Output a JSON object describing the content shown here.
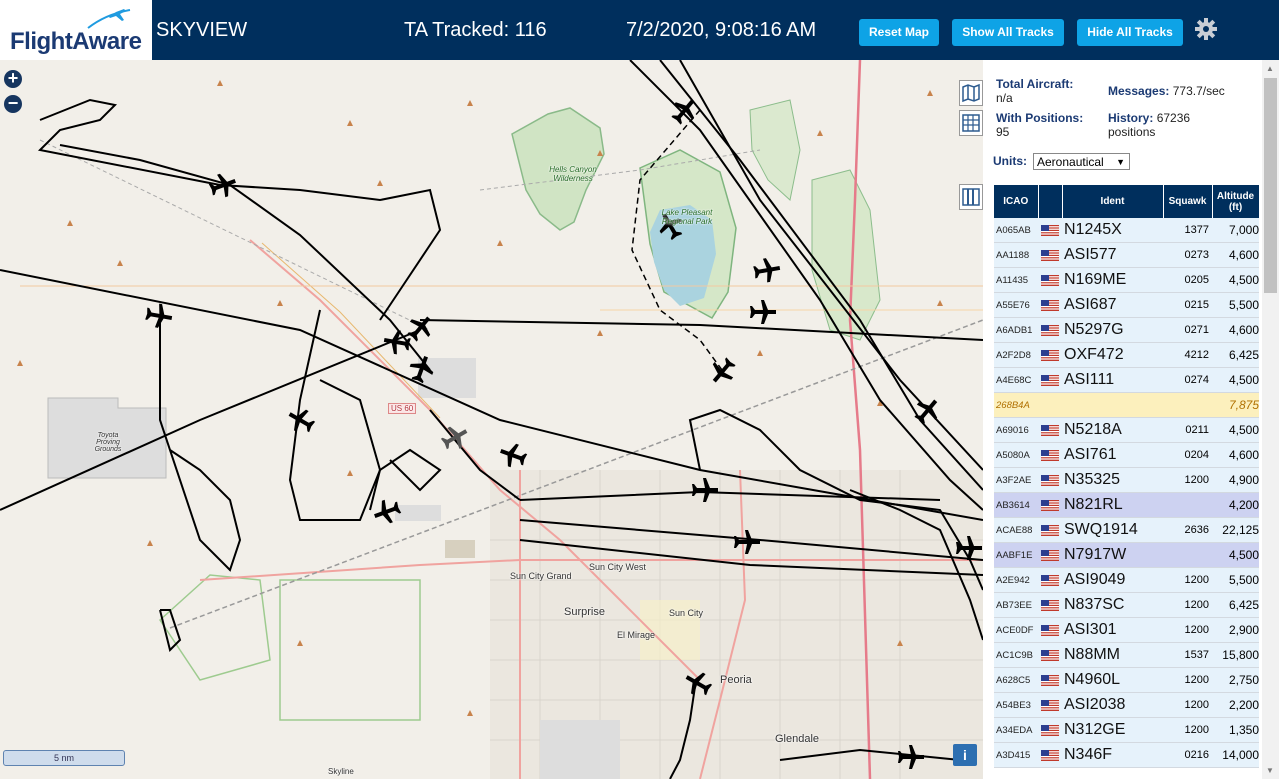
{
  "header": {
    "logo_text": "FlightAware",
    "app_title": "SKYVIEW",
    "tracked": "TA Tracked: 116",
    "datetime": "7/2/2020, 9:08:16 AM",
    "reset_label": "Reset Map",
    "show_label": "Show All Tracks",
    "hide_label": "Hide All Tracks"
  },
  "stats": {
    "total_label": "Total Aircraft:",
    "total_value": "n/a",
    "positions_label": "With Positions:",
    "positions_value": "95",
    "messages_label": "Messages:",
    "messages_value": "773.7/sec",
    "history_label": "History:",
    "history_value": "67236",
    "history_unit": "positions"
  },
  "units": {
    "label": "Units:",
    "value": "Aeronautical"
  },
  "table": {
    "headers": {
      "icao": "ICAO",
      "ident": "Ident",
      "squawk": "Squawk",
      "altitude": "Altitude (ft)"
    },
    "rows": [
      {
        "icao": "A065AB",
        "ident": "N1245X",
        "squawk": "1377",
        "alt": "7,000"
      },
      {
        "icao": "AA1188",
        "ident": "ASI577",
        "squawk": "0273",
        "alt": "4,600"
      },
      {
        "icao": "A11435",
        "ident": "N169ME",
        "squawk": "0205",
        "alt": "4,500"
      },
      {
        "icao": "A55E76",
        "ident": "ASI687",
        "squawk": "0215",
        "alt": "5,500"
      },
      {
        "icao": "A6ADB1",
        "ident": "N5297G",
        "squawk": "0271",
        "alt": "4,600"
      },
      {
        "icao": "A2F2D8",
        "ident": "OXF472",
        "squawk": "4212",
        "alt": "6,425"
      },
      {
        "icao": "A4E68C",
        "ident": "ASI111",
        "squawk": "0274",
        "alt": "4,500"
      },
      {
        "icao": "268B4A",
        "ident": "",
        "squawk": "",
        "alt": "7,875"
      },
      {
        "icao": "A69016",
        "ident": "N5218A",
        "squawk": "0211",
        "alt": "4,500"
      },
      {
        "icao": "A5080A",
        "ident": "ASI761",
        "squawk": "0204",
        "alt": "4,600"
      },
      {
        "icao": "A3F2AE",
        "ident": "N35325",
        "squawk": "1200",
        "alt": "4,900"
      },
      {
        "icao": "AB3614",
        "ident": "N821RL",
        "squawk": "",
        "alt": "4,200"
      },
      {
        "icao": "ACAE88",
        "ident": "SWQ1914",
        "squawk": "2636",
        "alt": "22,125"
      },
      {
        "icao": "AABF1E",
        "ident": "N7917W",
        "squawk": "",
        "alt": "4,500"
      },
      {
        "icao": "A2E942",
        "ident": "ASI9049",
        "squawk": "1200",
        "alt": "5,500"
      },
      {
        "icao": "AB73EE",
        "ident": "N837SC",
        "squawk": "1200",
        "alt": "6,425"
      },
      {
        "icao": "ACE0DF",
        "ident": "ASI301",
        "squawk": "1200",
        "alt": "2,900"
      },
      {
        "icao": "AC1C9B",
        "ident": "N88MM",
        "squawk": "1537",
        "alt": "15,800"
      },
      {
        "icao": "A628C5",
        "ident": "N4960L",
        "squawk": "1200",
        "alt": "2,750"
      },
      {
        "icao": "A54BE3",
        "ident": "ASI2038",
        "squawk": "1200",
        "alt": "2,200"
      },
      {
        "icao": "A34EDA",
        "ident": "N312GE",
        "squawk": "1200",
        "alt": "1,350"
      },
      {
        "icao": "A3D415",
        "ident": "N346F",
        "squawk": "0216",
        "alt": "14,000"
      }
    ]
  },
  "map": {
    "labels": {
      "hells_canyon": "Hells Canyon Wilderness",
      "lake_pleasant": "Lake Pleasant Regional Park",
      "toyota": "Toyota Proving Grounds",
      "us60": "US 60",
      "sun_city_grand": "Sun City Grand",
      "sun_city_west": "Sun City West",
      "surprise": "Surprise",
      "sun_city": "Sun City",
      "el_mirage": "El Mirage",
      "peoria": "Peoria",
      "glendale": "Glendale",
      "skyline": "Skyline"
    },
    "scale": "5 nm",
    "zoom_in": "+",
    "zoom_out": "−",
    "info": "i"
  }
}
